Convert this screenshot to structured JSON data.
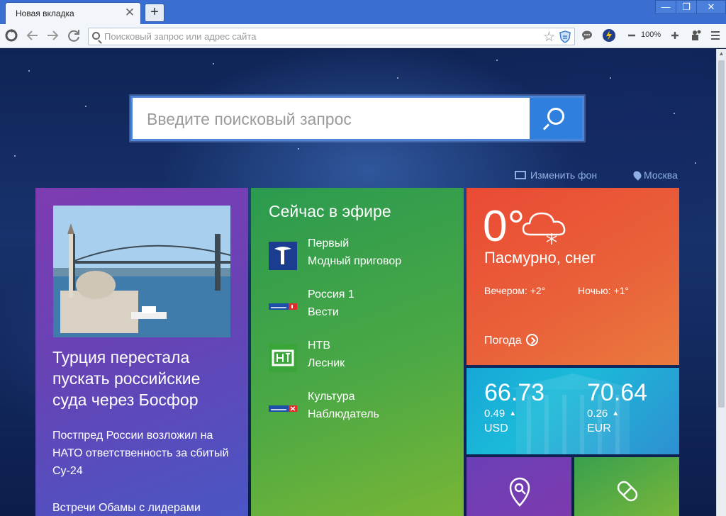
{
  "browser": {
    "tab_title": "Новая вкладка",
    "tab_close": "✕",
    "new_tab": "+",
    "window": {
      "minimize": "—",
      "maximize": "❐",
      "close": "✕"
    },
    "address_placeholder": "Поисковый запрос или адрес сайта",
    "zoom": "100%",
    "icons": [
      "reload-brand-icon",
      "back-icon",
      "forward-icon",
      "refresh-icon",
      "search-icon",
      "star-icon",
      "shield-icon",
      "chat-icon",
      "lightning-icon",
      "zoom-out-icon",
      "zoom-in-icon",
      "extension-icon",
      "menu-icon"
    ]
  },
  "search": {
    "placeholder": "Введите поисковый запрос"
  },
  "background_link": "Изменить фон",
  "city": "Москва",
  "news": {
    "title": "Турция перестала пускать российские суда через Босфор",
    "lead": "Постпред России возложил на НАТО ответственность за сбитый Су-24",
    "more": "Встречи Обамы с лидерами"
  },
  "tv": {
    "heading": "Сейчас в эфире",
    "items": [
      {
        "channel": "Первый",
        "show": "Модный приговор",
        "logo": "pervyi-logo"
      },
      {
        "channel": "Россия 1",
        "show": "Вести",
        "logo": "rossiya1-logo"
      },
      {
        "channel": "НТВ",
        "show": "Лесник",
        "logo": "ntv-logo"
      },
      {
        "channel": "Культура",
        "show": "Наблюдатель",
        "logo": "kultura-logo"
      }
    ]
  },
  "weather": {
    "temp": "0°",
    "description": "Пасмурно, снег",
    "evening": "Вечером: +2°",
    "night": "Ночью: +1°",
    "link": "Погода",
    "icon": "cloud-snow-icon"
  },
  "currency": [
    {
      "value": "66.73",
      "change": "0.49",
      "code": "USD"
    },
    {
      "value": "70.64",
      "change": "0.26",
      "code": "EUR"
    }
  ],
  "colors": {
    "titlebar": "#3a6fd1",
    "news_tile": "#6d40b5",
    "tv_tile": "#4aa845",
    "weather_tile": "#ea5a37",
    "currency_tile": "#1bb0d8",
    "search_button": "#2f7fde"
  }
}
